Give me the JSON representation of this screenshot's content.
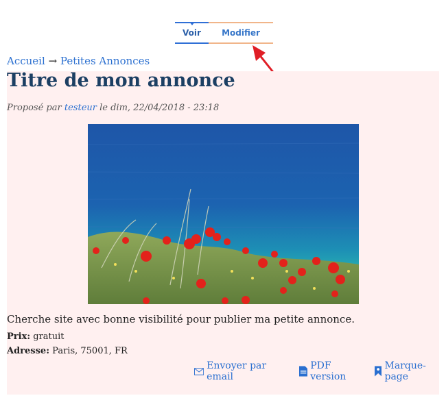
{
  "tabs": [
    {
      "label": "Voir"
    },
    {
      "label": "Modifier"
    }
  ],
  "breadcrumb": {
    "home": "Accueil",
    "separator": "→",
    "section": "Petites Annonces"
  },
  "article": {
    "title": "Titre de mon annonce",
    "meta_prefix": "Proposé par",
    "author": "testeur",
    "meta_suffix": "le dim, 22/04/2018 - 23:18",
    "body": "Cherche site avec bonne visibilité pour publier ma petite annonce.",
    "price_label": "Prix:",
    "price_value": "gratuit",
    "address_label": "Adresse:",
    "address_value": "Paris, 75001, FR"
  },
  "links": [
    {
      "icon": "envelope-icon",
      "label": "Envoyer par email"
    },
    {
      "icon": "pdf-icon",
      "label": "PDF version"
    },
    {
      "icon": "bookmark-icon",
      "label": "Marque-page"
    }
  ],
  "colors": {
    "accent": "#2a6fd0",
    "tab_active": "#2f6fd6",
    "tab_hover": "#f1b58a",
    "content_background": "#fff0f0",
    "title": "#1c3f63",
    "arrow": "#e01e26"
  }
}
